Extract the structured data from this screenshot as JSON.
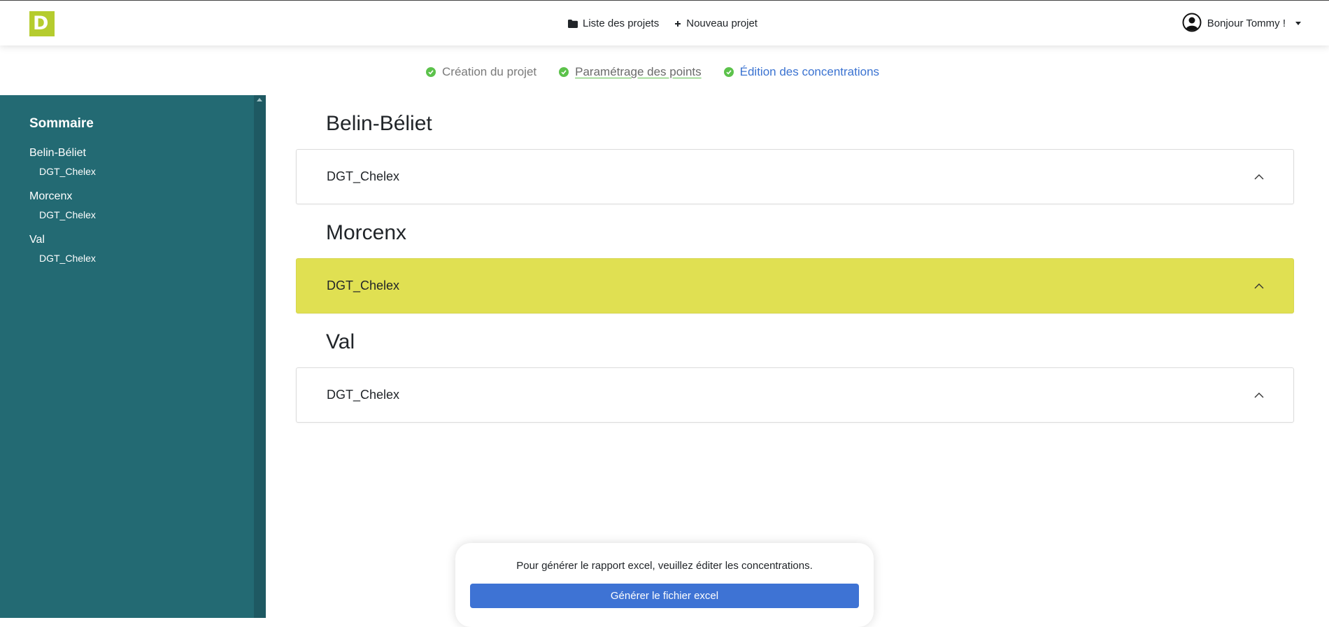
{
  "brand": {
    "logo_letter": "D",
    "logo_color": "#b5cc2e"
  },
  "nav": {
    "projects_label": "Liste des projets",
    "projects_icon": "folder-icon",
    "new_label": "Nouveau projet",
    "new_icon": "plus-icon",
    "user_greeting": "Bonjour Tommy !",
    "user_icon": "user-circle-icon"
  },
  "stepper": {
    "steps": [
      {
        "label": "Création du projet",
        "status": "done"
      },
      {
        "label": "Paramétrage des points",
        "status": "done"
      },
      {
        "label": "Édition des concentrations",
        "status": "current"
      }
    ],
    "check_color": "#5cc24b"
  },
  "sidebar": {
    "title": "Sommaire",
    "groups": [
      {
        "label": "Belin-Béliet",
        "items": [
          "DGT_Chelex"
        ]
      },
      {
        "label": "Morcenx",
        "items": [
          "DGT_Chelex"
        ]
      },
      {
        "label": "Val",
        "items": [
          "DGT_Chelex"
        ]
      }
    ],
    "background": "#236a73"
  },
  "sections": [
    {
      "title": "Belin-Béliet",
      "accordions": [
        {
          "label": "DGT_Chelex",
          "highlighted": false
        }
      ]
    },
    {
      "title": "Morcenx",
      "accordions": [
        {
          "label": "DGT_Chelex",
          "highlighted": true
        }
      ]
    },
    {
      "title": "Val",
      "accordions": [
        {
          "label": "DGT_Chelex",
          "highlighted": false
        }
      ]
    }
  ],
  "report": {
    "message": "Pour générer le rapport excel, veuillez éditer les concentrations.",
    "button_label": "Générer le fichier excel",
    "button_color": "#3e73d4"
  },
  "colors": {
    "highlight": "#e0e052",
    "link": "#3b73d1"
  }
}
